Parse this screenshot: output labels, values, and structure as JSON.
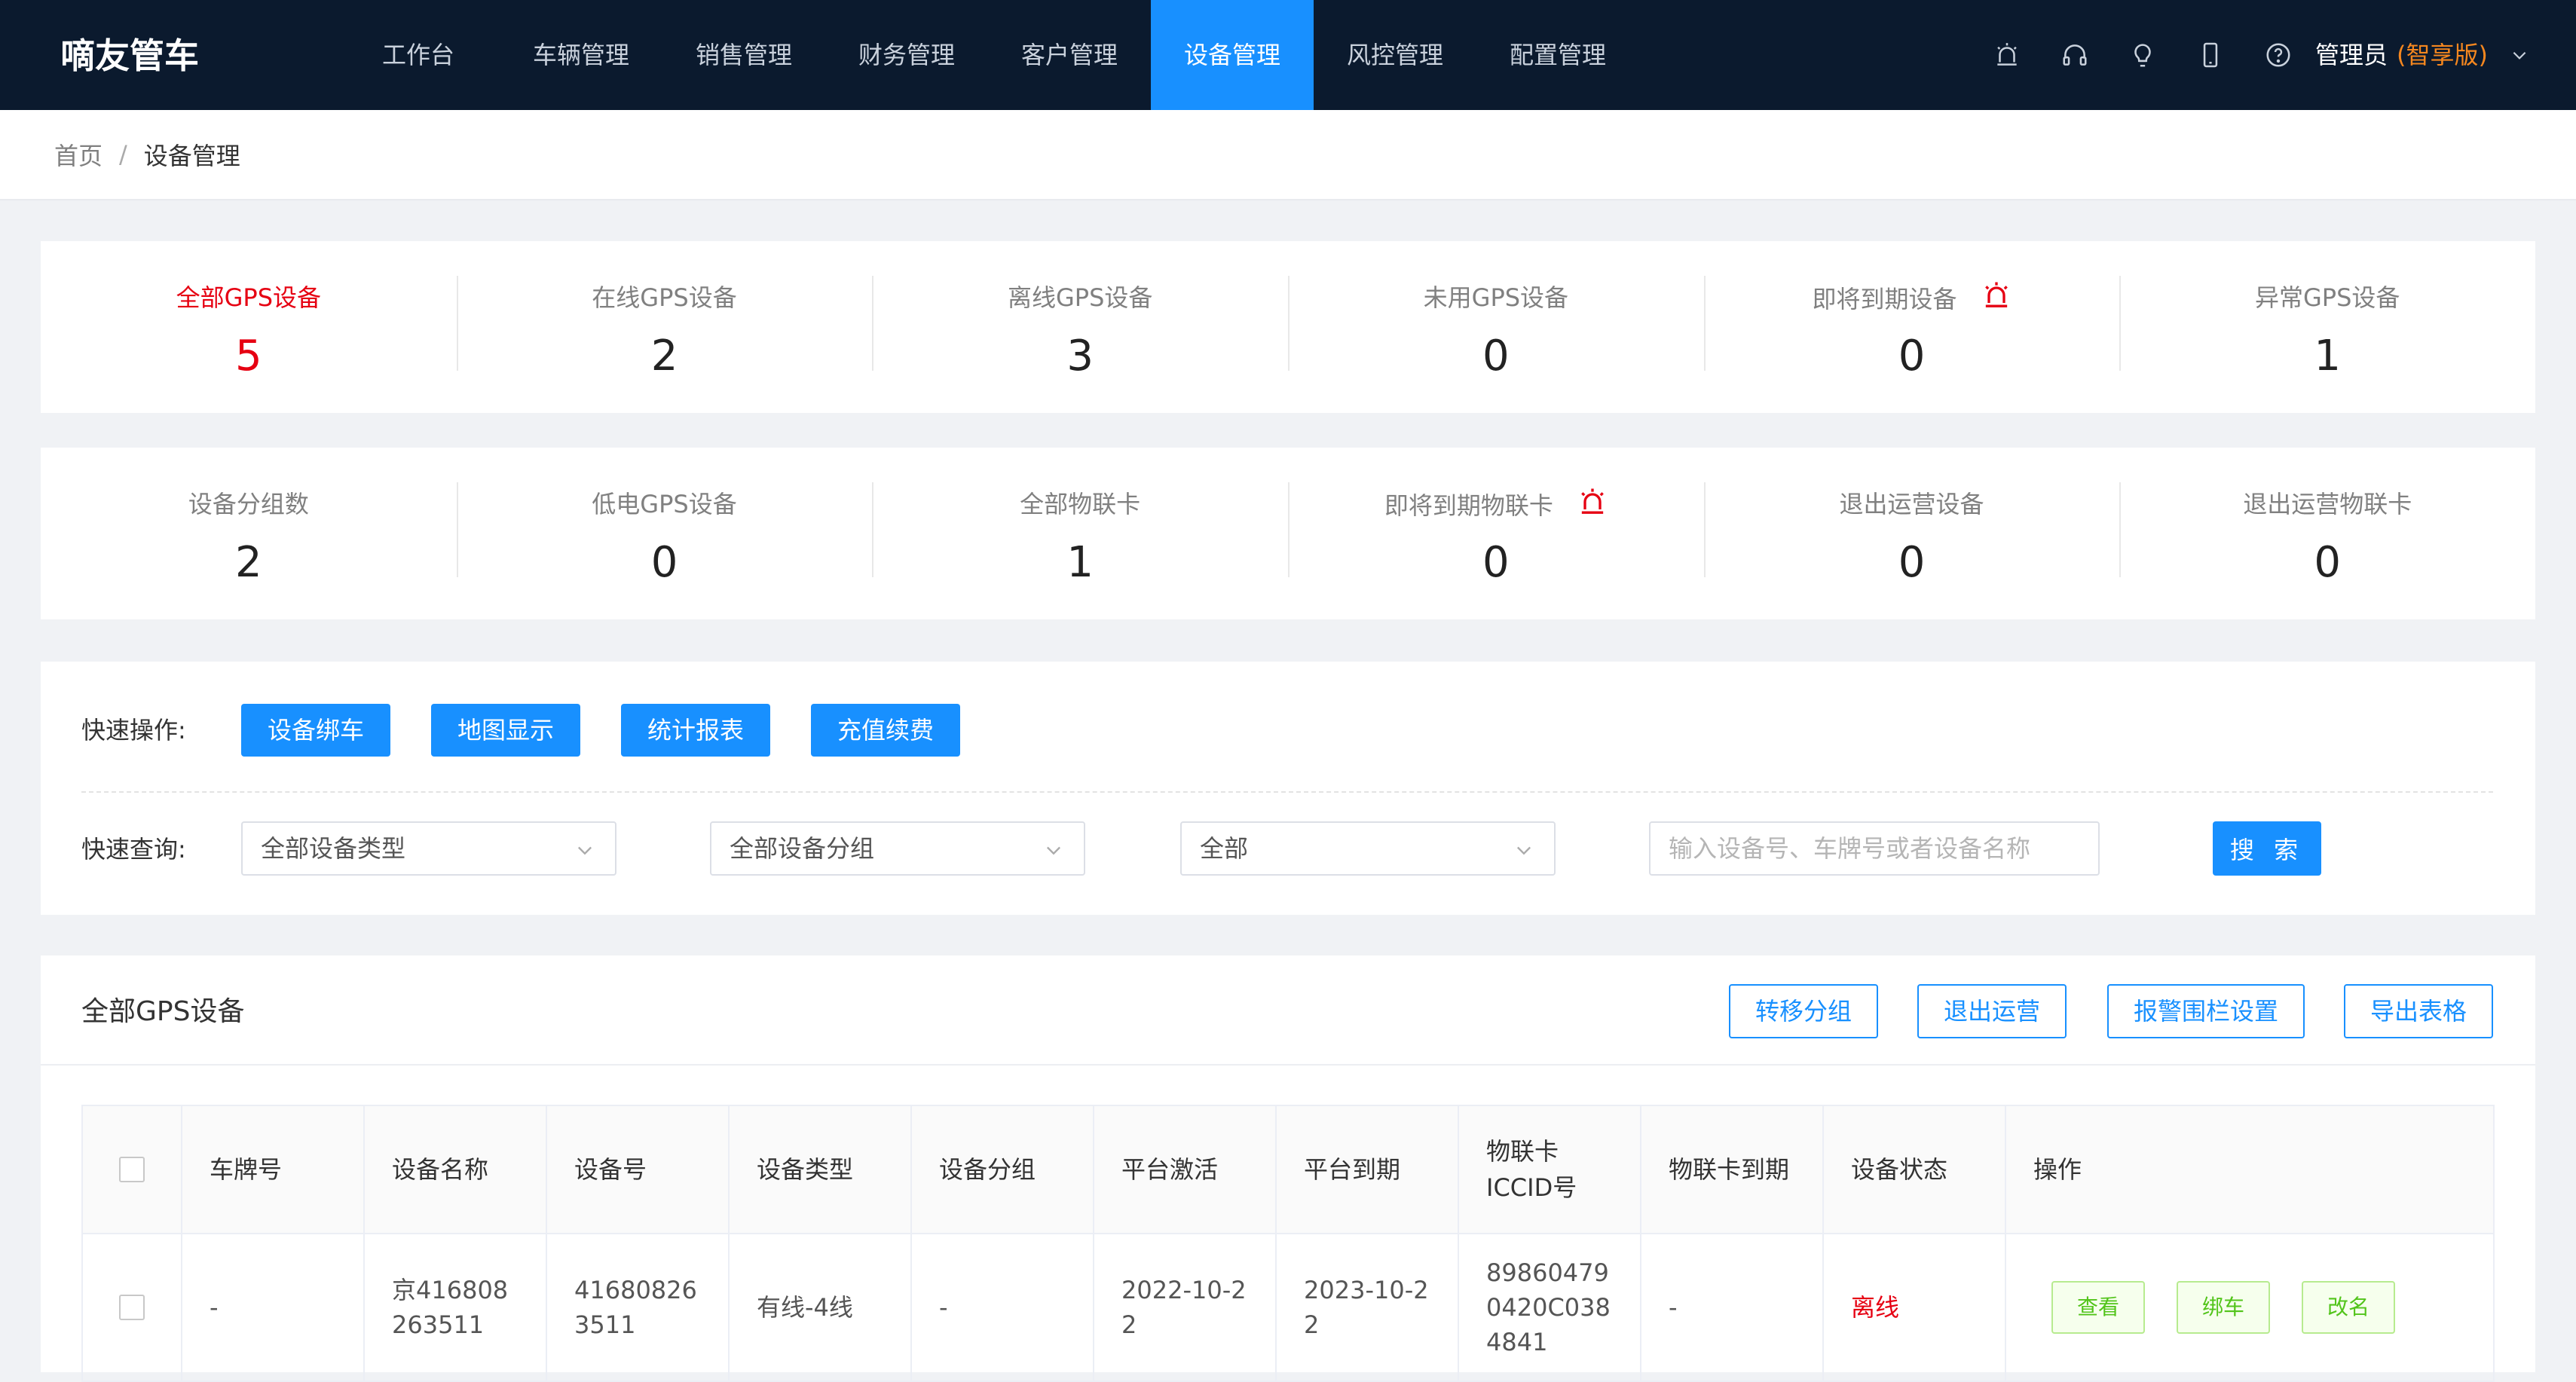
{
  "app": {
    "logo": "嘀友管车"
  },
  "nav": {
    "items": [
      {
        "label": "工作台"
      },
      {
        "label": "车辆管理"
      },
      {
        "label": "销售管理"
      },
      {
        "label": "财务管理"
      },
      {
        "label": "客户管理"
      },
      {
        "label": "设备管理",
        "active": true
      },
      {
        "label": "风控管理"
      },
      {
        "label": "配置管理"
      }
    ]
  },
  "header_icons": [
    "alarm-icon",
    "headset-icon",
    "lightbulb-icon",
    "mobile-icon",
    "help-icon"
  ],
  "user": {
    "name": "管理员",
    "edition": "(智享版)"
  },
  "breadcrumb": {
    "home": "首页",
    "separator": "/",
    "current": "设备管理"
  },
  "stats_row1": [
    {
      "label": "全部GPS设备",
      "value": "5",
      "highlight": true
    },
    {
      "label": "在线GPS设备",
      "value": "2"
    },
    {
      "label": "离线GPS设备",
      "value": "3"
    },
    {
      "label": "未用GPS设备",
      "value": "0"
    },
    {
      "label": "即将到期设备",
      "value": "0",
      "alarm": true
    },
    {
      "label": "异常GPS设备",
      "value": "1"
    }
  ],
  "stats_row2": [
    {
      "label": "设备分组数",
      "value": "2"
    },
    {
      "label": "低电GPS设备",
      "value": "0"
    },
    {
      "label": "全部物联卡",
      "value": "1"
    },
    {
      "label": "即将到期物联卡",
      "value": "0",
      "alarm": true
    },
    {
      "label": "退出运营设备",
      "value": "0"
    },
    {
      "label": "退出运营物联卡",
      "value": "0"
    }
  ],
  "quick": {
    "ops_label": "快速操作:",
    "ops": [
      "设备绑车",
      "地图显示",
      "统计报表",
      "充值续费"
    ],
    "query_label": "快速查询:",
    "selects": [
      "全部设备类型",
      "全部设备分组",
      "全部"
    ],
    "search_placeholder": "输入设备号、车牌号或者设备名称",
    "search_button": "搜 索"
  },
  "panel": {
    "title": "全部GPS设备",
    "actions": [
      "转移分组",
      "退出运营",
      "报警围栏设置",
      "导出表格"
    ]
  },
  "table": {
    "headers": [
      "车牌号",
      "设备名称",
      "设备号",
      "设备类型",
      "设备分组",
      "平台激活",
      "平台到期",
      "物联卡ICCID号",
      "物联卡到期",
      "设备状态",
      "操作"
    ],
    "rows": [
      {
        "plate": "-",
        "device_name": "京416808263511",
        "device_no": "416808263511",
        "device_type": "有线-4线",
        "group": "-",
        "activated": "2022-10-22",
        "expires": "2023-10-22",
        "iccid": "898604790420C0384841",
        "card_expiry": "-",
        "status": "离线",
        "ops": [
          "查看",
          "绑车",
          "改名"
        ]
      }
    ]
  },
  "colors": {
    "header_bg": "#0b1a2e",
    "primary": "#1890ff",
    "danger": "#e60012",
    "edition": "#f5871f",
    "success": "#52c41a"
  }
}
